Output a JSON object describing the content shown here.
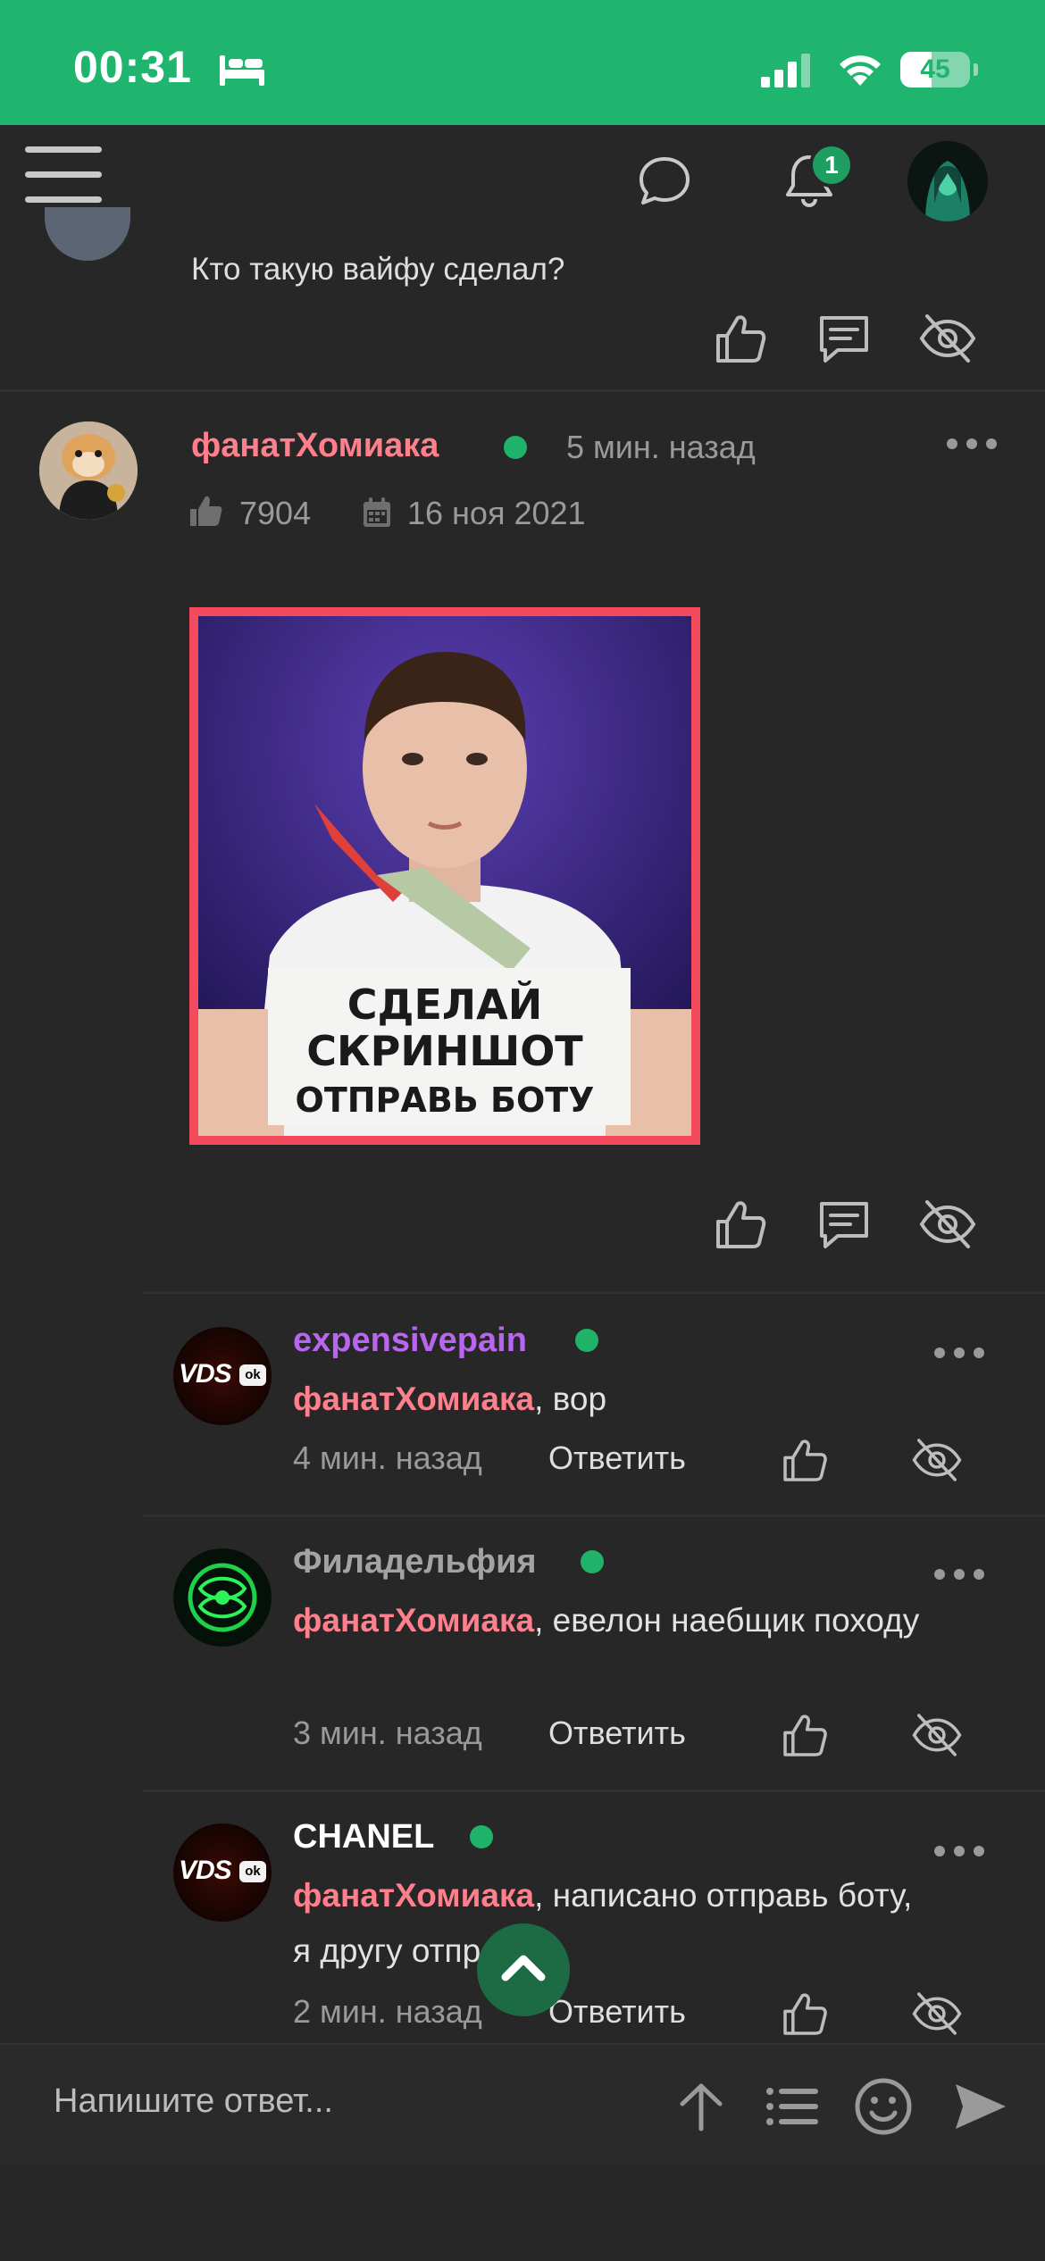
{
  "status_bar": {
    "time": "00:31",
    "battery": "45",
    "battery_level": 0.45,
    "accent_color": "#20b56f"
  },
  "app_bar": {
    "icons": [
      "menu-icon",
      "chat-icon",
      "bell-icon",
      "avatar"
    ],
    "notification_count": "1"
  },
  "previous_post": {
    "text": "Кто такую вайфу сделал?"
  },
  "post": {
    "author": "фанатХомиака",
    "time": "5 мин. назад",
    "likes": "7904",
    "registered": "16 ноя 2021",
    "image_caption": {
      "line1": "СДЕЛАЙ",
      "line2": "СКРИНШОТ",
      "line3": "ОТПРАВЬ БОТУ"
    }
  },
  "comments": [
    {
      "author": "expensivepain",
      "author_color": "#b865f0",
      "mention": "фанатХомиака",
      "text": ", вор",
      "time": "4 мин. назад",
      "reply_label": "Ответить"
    },
    {
      "author": "Филадельфия",
      "author_color": "#a3a3a3",
      "mention": "фанатХомиака",
      "text": ", евелон наебщик походу",
      "time": "3 мин. назад",
      "reply_label": "Ответить"
    },
    {
      "author": "CHANEL",
      "author_color": "#ffffff",
      "mention": "фанатХомиака",
      "text": ", написано отправь боту, я другу отправил",
      "time": "2 мин. назад",
      "reply_label": "Ответить"
    }
  ],
  "compose": {
    "placeholder": "Напишите ответ..."
  },
  "avatar_badge": {
    "vds_text": "VDS",
    "vds_ok": "ok"
  }
}
